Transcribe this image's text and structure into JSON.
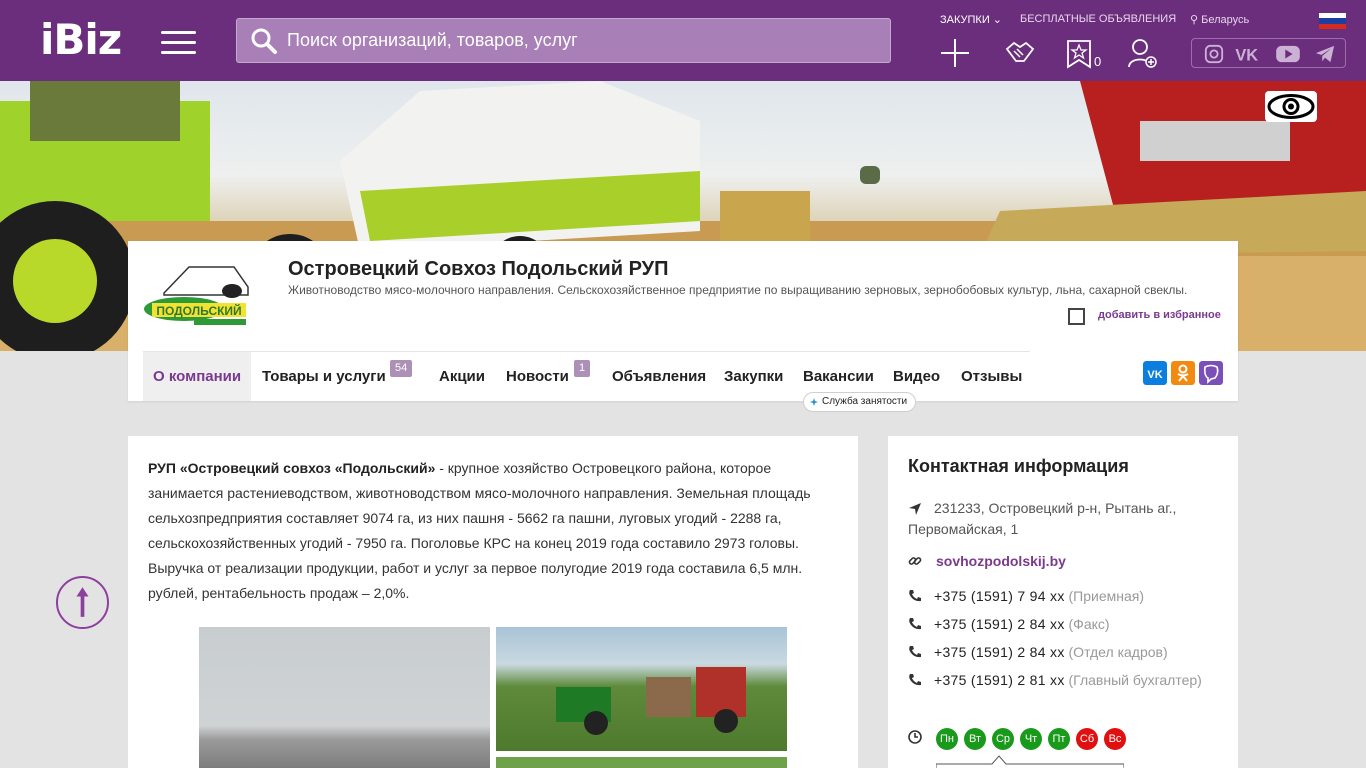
{
  "header": {
    "logo": "iBiz",
    "search_placeholder": "Поиск организаций, товаров, услуг",
    "links": {
      "zakupki": "ЗАКУПКИ",
      "free_ads": "БЕСПЛАТНЫЕ ОБЪЯВЛЕНИЯ",
      "region": "Беларусь"
    },
    "favorites_count": "0",
    "accent": "#6b2e7d"
  },
  "company": {
    "logo_text": "ПОДОЛЬСКИЙ",
    "title": "Островецкий Совхоз Подольский РУП",
    "subtitle": "Животноводство мясо-молочного направления. Сельскохозяйственное предприятие по выращиванию зерновых, зернобобовых культур, льна, сахарной свеклы.",
    "favorite_label": "добавить в избранное"
  },
  "tabs": [
    {
      "label": "О компании"
    },
    {
      "label": "Товары и услуги",
      "badge": "54"
    },
    {
      "label": "Акции"
    },
    {
      "label": "Новости",
      "badge": "1"
    },
    {
      "label": "Объявления"
    },
    {
      "label": "Закупки"
    },
    {
      "label": "Вакансии"
    },
    {
      "label": "Видео"
    },
    {
      "label": "Отзывы"
    }
  ],
  "employment_tip": "Служба занятости",
  "about": {
    "lead": "РУП «Островецкий совхоз «Подольский»",
    "text": " - крупное хозяйство Островецкого района, которое занимается растениеводством, животноводством мясо-молочного направления.  Земельная площадь сельхозпредприятия составляет  9074 га, из них пашня - 5662 га пашни, луговых угодий - 2288 га, сельскохозяйственных угодий -  7950 га. Поголовье КРС на конец 2019 года составило 2973 головы. Выручка от реализации продукции, работ и услуг за первое полугодие 2019 года составила 6,5 млн. рублей, рентабельность продаж – 2,0%."
  },
  "contacts": {
    "title": "Контактная информация",
    "address": "231233, Островецкий р-н, Рытань аг., Первомайская, 1",
    "site": "sovhozpodolskij.by",
    "phones": [
      {
        "number": "+375 (1591) 7 94 xx",
        "note": "(Приемная)"
      },
      {
        "number": "+375 (1591) 2 84 xx",
        "note": "(Факс)"
      },
      {
        "number": "+375 (1591) 2 84 xx",
        "note": "(Отдел кадров)"
      },
      {
        "number": "+375 (1591) 2 81 xx",
        "note": "(Главный бухгалтер)"
      }
    ],
    "days": [
      {
        "label": "Пн",
        "color": "#1a9a1a"
      },
      {
        "label": "Вт",
        "color": "#1a9a1a"
      },
      {
        "label": "Ср",
        "color": "#1a9a1a"
      },
      {
        "label": "Чт",
        "color": "#1a9a1a"
      },
      {
        "label": "Пт",
        "color": "#1a9a1a"
      },
      {
        "label": "Сб",
        "color": "#e01010"
      },
      {
        "label": "Вс",
        "color": "#e01010"
      }
    ]
  }
}
